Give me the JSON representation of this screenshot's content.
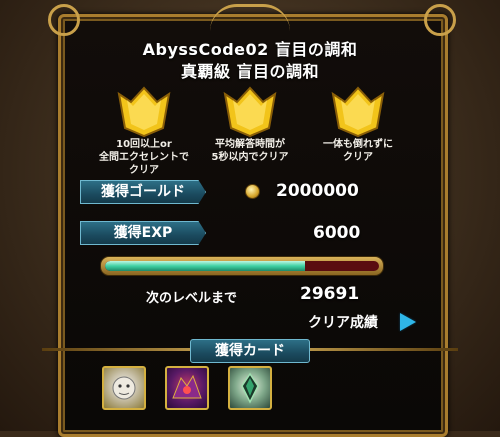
{
  "quest": {
    "title": "AbyssCode02 盲目の調和",
    "subtitle": "真覇級 盲目の調和"
  },
  "conditions": [
    {
      "line1": "10回以上or",
      "line2": "全問エクセレントで",
      "line3": "クリア"
    },
    {
      "line1": "平均解答時間が",
      "line2": "5秒以内でクリア",
      "line3": ""
    },
    {
      "line1": "一体も倒れずに",
      "line2": "クリア",
      "line3": ""
    }
  ],
  "rewards": {
    "gold_label": "獲得ゴールド",
    "gold_value": "2000000",
    "exp_label": "獲得EXP",
    "exp_value": "6000",
    "exp_progress": 0.73
  },
  "level": {
    "next_label": "次のレベルまで",
    "next_value": "29691"
  },
  "clear_results_label": "クリア成績",
  "cards": {
    "label": "獲得カード",
    "items": [
      {
        "name": "white-beast-card-icon"
      },
      {
        "name": "purple-dragon-card-icon"
      },
      {
        "name": "green-crystal-card-icon"
      }
    ]
  },
  "colors": {
    "crown": "#f2c41a",
    "label_bg": "#1b4b5f",
    "exp_fill": "#3fd1a4",
    "exp_empty": "#5a0d10",
    "play": "#2fb6e8"
  }
}
